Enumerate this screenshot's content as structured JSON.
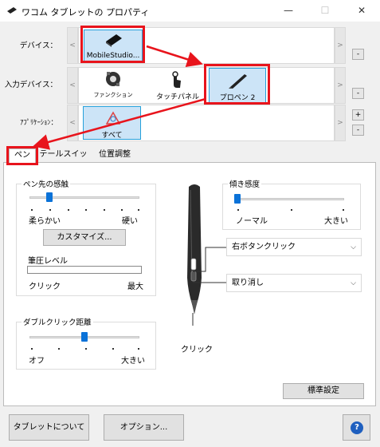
{
  "window": {
    "title": "ワコム タブレットの プロパティ",
    "minimize": "—",
    "maximize": "☐",
    "close": "✕"
  },
  "rows": {
    "device": {
      "label": "デバイス：",
      "tiles": [
        {
          "label": "MobileStudio..."
        }
      ]
    },
    "input": {
      "label": "入力デバイス：",
      "tiles": [
        {
          "label": "ファンクション"
        },
        {
          "label": "タッチパネル"
        },
        {
          "label": "プロペン 2"
        }
      ]
    },
    "app": {
      "label": "ｱﾌﾟﾘｹｰｼｮﾝ：",
      "tiles": [
        {
          "label": "すべて"
        }
      ]
    }
  },
  "scroll": {
    "left": "<",
    "right": ">"
  },
  "side_buttons": {
    "minus": "-",
    "plus": "+"
  },
  "tabs": [
    {
      "label": "ペン"
    },
    {
      "label": "テールスイッチ"
    },
    {
      "label": "位置調整"
    }
  ],
  "pen_feel": {
    "title": "ペン先の感触",
    "min_label": "柔らかい",
    "max_label": "硬い",
    "level": 0.17,
    "customize_button": "カスタマイズ...",
    "pressure_label": "筆圧レベル",
    "pressure_min": "クリック",
    "pressure_max": "最大"
  },
  "tilt": {
    "title": "傾き感度",
    "min_label": "ノーマル",
    "max_label": "大きい",
    "level": 0.0
  },
  "double_click": {
    "title": "ダブルクリック距離",
    "min_label": "オフ",
    "max_label": "大きい",
    "level": 0.5
  },
  "pen_buttons": {
    "upper": "右ボタンクリック",
    "lower": "取り消し",
    "tip": "クリック"
  },
  "default_button": "標準設定",
  "bottom": {
    "about": "タブレットについて",
    "options": "オプション...",
    "help": "?"
  }
}
